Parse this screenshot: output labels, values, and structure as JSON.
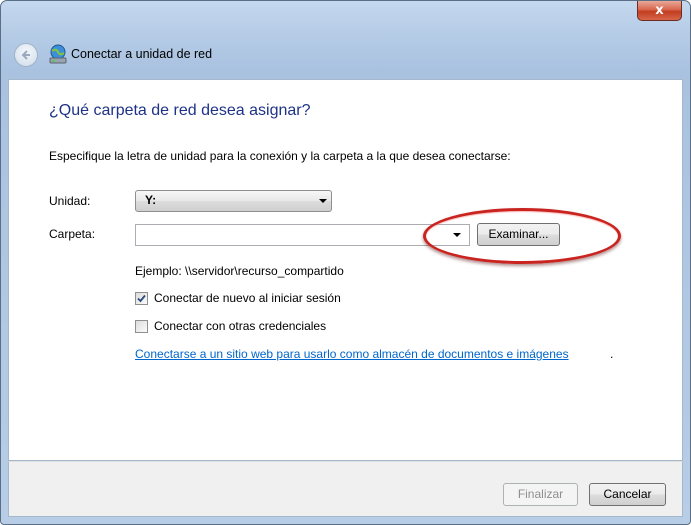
{
  "window": {
    "title": "Conectar a unidad de red",
    "close_glyph": "x"
  },
  "content": {
    "heading": "¿Qué carpeta de red desea asignar?",
    "instruction": "Especifique la letra de unidad para la conexión y la carpeta a la que desea conectarse:",
    "drive": {
      "label": "Unidad:",
      "selected": "Y:"
    },
    "folder": {
      "label": "Carpeta:",
      "value": "",
      "browse_label": "Examinar..."
    },
    "example": "Ejemplo: \\\\servidor\\recurso_compartido",
    "reconnect": {
      "label": "Conectar de nuevo al iniciar sesión",
      "checked": true
    },
    "other_credentials": {
      "label": "Conectar con otras credenciales",
      "checked": false
    },
    "link": "Conectarse a un sitio web para usarlo como almacén de documentos e imágenes",
    "link_suffix": "."
  },
  "footer": {
    "finish_label": "Finalizar",
    "finish_enabled": false,
    "cancel_label": "Cancelar"
  },
  "icons": {
    "back": "back-arrow-icon",
    "title": "network-drive-icon",
    "close": "close-icon"
  },
  "colors": {
    "heading": "#1e3287",
    "link": "#0066cc",
    "highlight": "#c9241f",
    "close_button": "#c13d20"
  }
}
